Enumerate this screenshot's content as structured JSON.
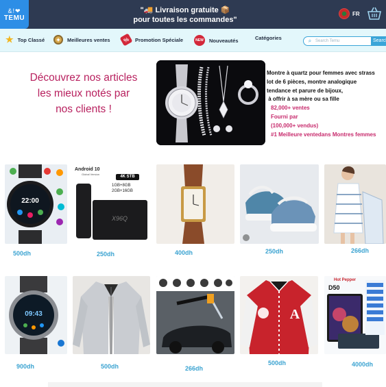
{
  "header": {
    "logo_glyphs": "&!❤",
    "logo_name": "TEMU",
    "promo_line1": "🚚 Livraison gratuite 📦",
    "promo_line2": "pour toutes les commandes\"",
    "promo_open_quote": "\"",
    "language": "FR"
  },
  "nav": {
    "items": [
      {
        "label": "Top Classé",
        "icon": "star-icon"
      },
      {
        "label": "Meilleures ventes",
        "icon": "medal-icon"
      },
      {
        "label": "Promotion Spéciale",
        "icon": "tag-icon"
      },
      {
        "label": "Nouveautés",
        "icon": "new-badge-icon"
      },
      {
        "label": "Catégories",
        "icon": ""
      }
    ],
    "search_placeholder": "Search Temu",
    "search_button": "Search"
  },
  "hero": {
    "title_line1": "Découvrez nos articles",
    "title_line2": "les mieux notés par",
    "title_line3": "nos clients !",
    "desc_line1": "Montre à quartz pour femmes avec strass",
    "desc_line2": "lot de 6 pièces, montre analogique",
    "desc_line3": "tendance et parure de bijoux,",
    "desc_line4": " à offrir à sa mère ou sa fille",
    "sold": "82,000+ ventes",
    "supplied_by": "Fourni par",
    "supplied_count": "(100,000+ vendus)",
    "rank": "#1 Meilleure ventedans Montres femmes"
  },
  "products_row1": [
    {
      "price": "500dh",
      "image": "smartwatch"
    },
    {
      "price": "250dh",
      "image": "android-tv-box",
      "badge_os": "Android 10",
      "badge_os_sub": "Global Version",
      "badge_res": "4K STB",
      "spec1": "1GB+8GB",
      "spec2": "2GB+16GB",
      "brand": "X96Q"
    },
    {
      "price": "400dh",
      "image": "leather-watch"
    },
    {
      "price": "250dh",
      "image": "sneakers"
    },
    {
      "price": "266dh",
      "image": "towel-dress"
    }
  ],
  "products_row2": [
    {
      "price": "900dh",
      "image": "round-smartwatch",
      "time": "09:43"
    },
    {
      "price": "500dh",
      "image": "zip-jacket"
    },
    {
      "price": "266dh",
      "image": "pressure-washer"
    },
    {
      "price": "500dh",
      "image": "varsity-jacket",
      "letter": "A"
    },
    {
      "price": "4000dh",
      "image": "tablet-keyboard",
      "brand": "Hot Pepper",
      "model": "D50"
    }
  ],
  "colors": {
    "header_bg": "#2e3a52",
    "nav_bg": "#e3f7fb",
    "accent_blue": "#3aa5d8",
    "hero_pink": "#b8215f",
    "price_blue": "#3ba3d1"
  }
}
